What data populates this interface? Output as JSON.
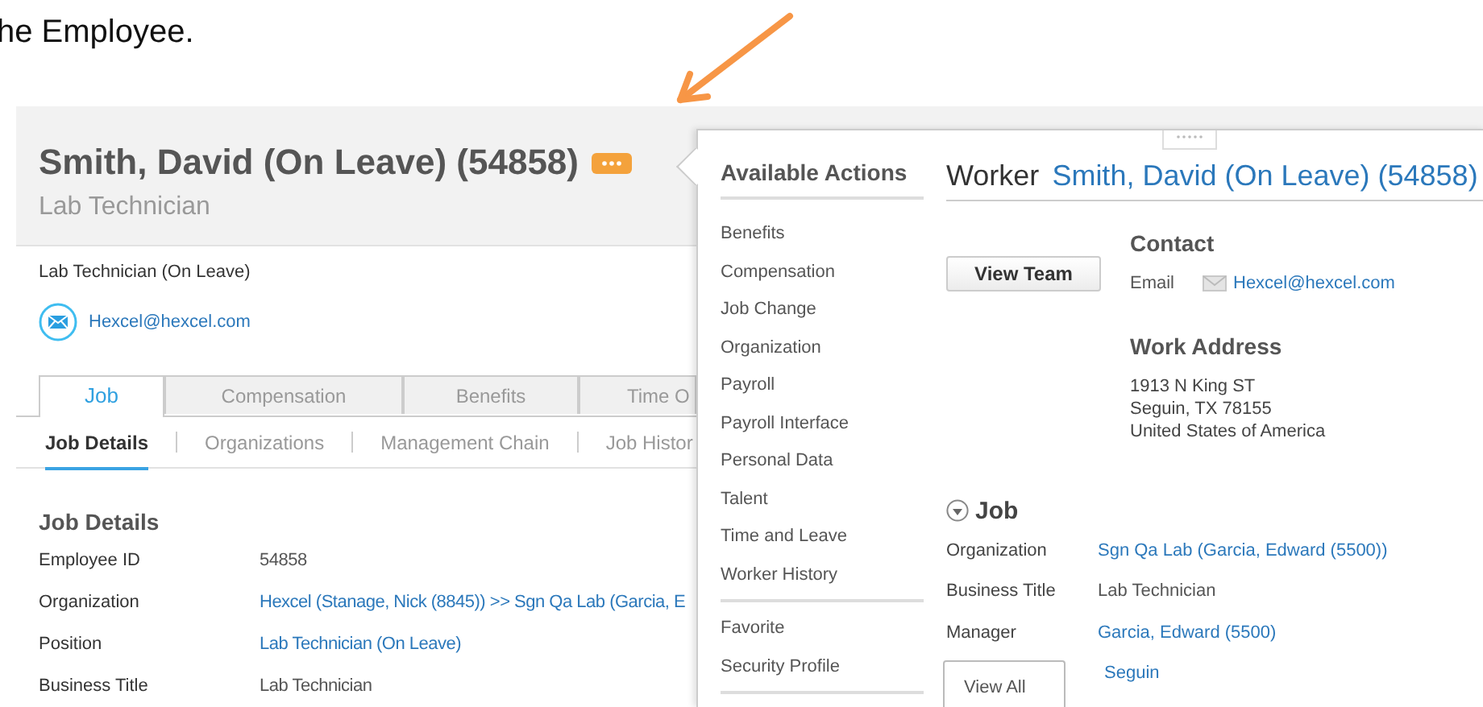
{
  "document_text": "he Employee.",
  "profile": {
    "name": "Smith, David (On Leave) (54858)",
    "subtitle": "Lab Technician",
    "position": "Lab Technician (On Leave)",
    "email": "Hexcel@hexcel.com",
    "tabs": [
      {
        "label": "Job",
        "selected": true
      },
      {
        "label": "Compensation",
        "selected": false
      },
      {
        "label": "Benefits",
        "selected": false
      },
      {
        "label": "Time O",
        "selected": false
      }
    ],
    "subtabs": [
      {
        "label": "Job Details",
        "selected": true
      },
      {
        "label": "Organizations",
        "selected": false
      },
      {
        "label": "Management Chain",
        "selected": false
      },
      {
        "label": "Job Histor",
        "selected": false
      }
    ],
    "section_title": "Job Details",
    "fields": [
      {
        "label": "Employee ID",
        "value": "54858",
        "kind": "text"
      },
      {
        "label": "Organization",
        "value": "Hexcel (Stanage, Nick (8845)) >> Sgn Qa Lab (Garcia, E",
        "kind": "link"
      },
      {
        "label": "Position",
        "value": "Lab Technician (On Leave)",
        "kind": "link"
      },
      {
        "label": "Business Title",
        "value": "Lab Technician",
        "kind": "text"
      }
    ]
  },
  "popup": {
    "title": "Available Actions",
    "action_groups": [
      [
        "Benefits",
        "Compensation",
        "Job Change",
        "Organization",
        "Payroll",
        "Payroll Interface",
        "Personal Data",
        "Talent",
        "Time and Leave",
        "Worker History"
      ],
      [
        "Favorite",
        "Security Profile"
      ]
    ],
    "worker_label": "Worker",
    "worker_name": "Smith, David (On Leave) (54858)",
    "view_team": "View Team",
    "contact": {
      "title": "Contact",
      "email_label": "Email",
      "email": "Hexcel@hexcel.com"
    },
    "work_address": {
      "title": "Work Address",
      "lines": [
        "1913 N King ST",
        "Seguin, TX 78155",
        "United States of America"
      ]
    },
    "job": {
      "title": "Job",
      "expanded": true,
      "fields": [
        {
          "label": "Organization",
          "value": "Sgn Qa Lab (Garcia, Edward (5500))",
          "kind": "link"
        },
        {
          "label": "Business Title",
          "value": "Lab Technician",
          "kind": "text"
        },
        {
          "label": "Manager",
          "value": "Garcia, Edward (5500)",
          "kind": "link"
        }
      ]
    },
    "view_all": "View All",
    "extra_link": "Seguin"
  }
}
